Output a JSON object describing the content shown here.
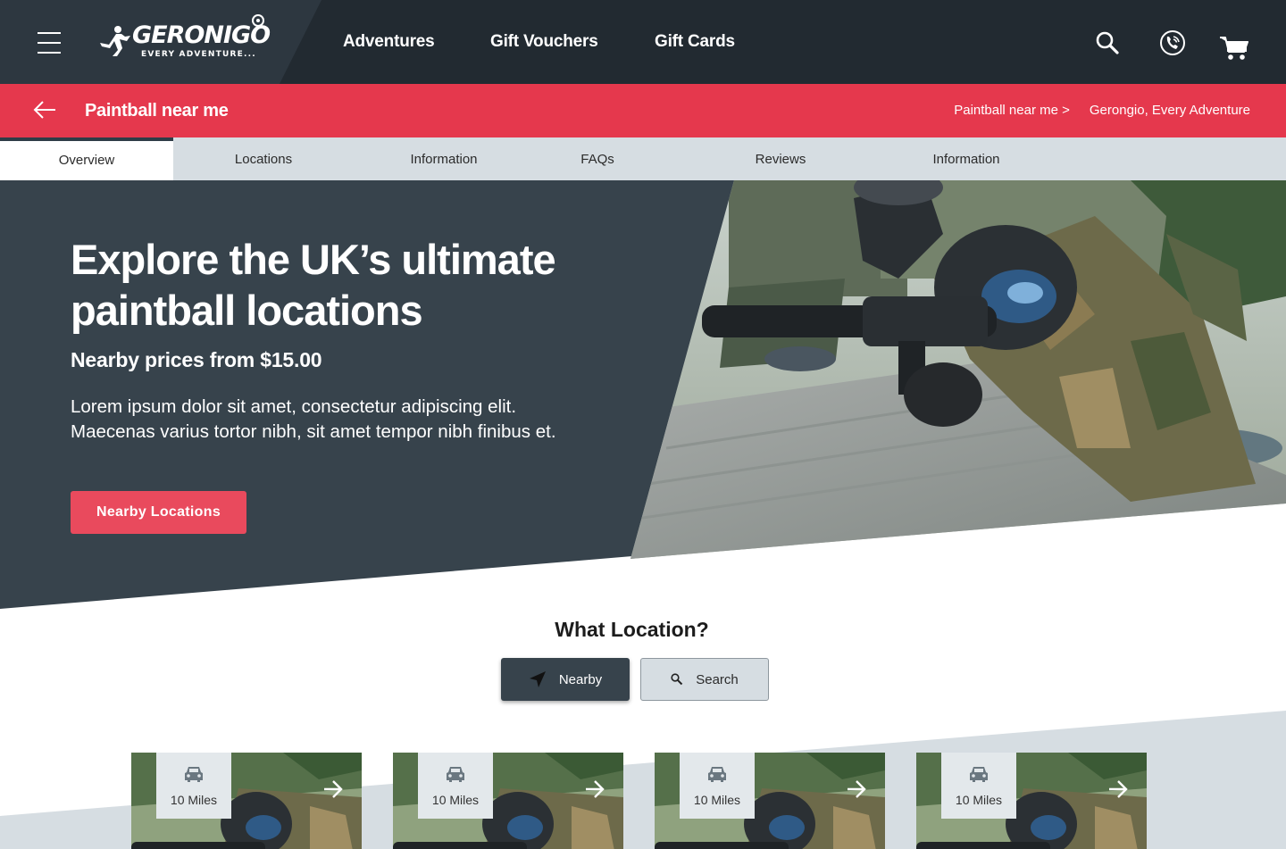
{
  "brand": {
    "name": "GERONIGO",
    "tagline": "EVERY ADVENTURE..."
  },
  "header": {
    "nav": [
      "Adventures",
      "Gift Vouchers",
      "Gift Cards"
    ],
    "icons": [
      "menu-icon",
      "search-icon",
      "phone-icon",
      "cart-icon"
    ]
  },
  "titlebar": {
    "title": "Paintball near me",
    "breadcrumbs": [
      "Paintball near me >",
      "Gerongio, Every Adventure"
    ]
  },
  "tabs": [
    "Overview",
    "Locations",
    "Information",
    "FAQs",
    "Reviews",
    "Information"
  ],
  "hero": {
    "heading": "Explore the UK’s ultimate paintball locations",
    "price": "Nearby prices from $15.00",
    "description": "Lorem ipsum dolor sit amet, consectetur adipiscing elit. Maecenas varius tortor nibh, sit amet tempor nibh finibus et.",
    "cta": "Nearby Locations"
  },
  "location": {
    "title": "What Location?",
    "nearby_label": "Nearby",
    "search_label": "Search"
  },
  "cards": [
    {
      "distance": "10 Miles"
    },
    {
      "distance": "10 Miles"
    },
    {
      "distance": "10 Miles"
    },
    {
      "distance": "10 Miles"
    }
  ],
  "colors": {
    "header_bg": "#222a31",
    "accent_red": "#e5384d",
    "hero_bg": "#37434c",
    "tab_bg": "#d6dde2"
  }
}
